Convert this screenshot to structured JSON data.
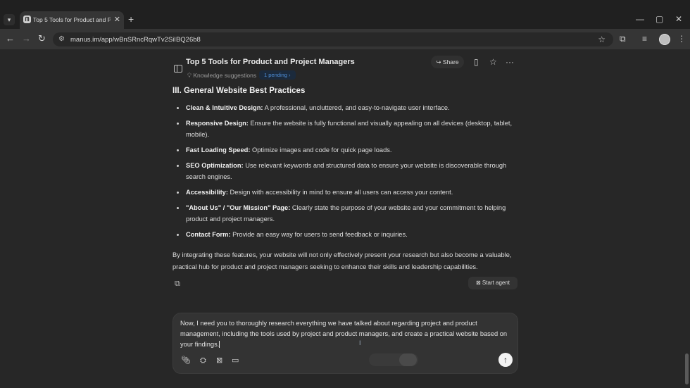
{
  "browser": {
    "tab": {
      "title": "Top 5 Tools for Product and Pro"
    },
    "url": "manus.im/app/wBnSRncRqwTv2SiIBQ26b8"
  },
  "header": {
    "title": "Top 5 Tools for Product and Project Managers",
    "knowledge_label": "Knowledge suggestions",
    "pending_badge": "1 pending",
    "share_label": "Share"
  },
  "content": {
    "section_title": "III. General Website Best Practices",
    "items": [
      {
        "label": "Clean & Intuitive Design:",
        "text": " A professional, uncluttered, and easy-to-navigate user interface."
      },
      {
        "label": "Responsive Design:",
        "text": " Ensure the website is fully functional and visually appealing on all devices (desktop, tablet, mobile)."
      },
      {
        "label": "Fast Loading Speed:",
        "text": " Optimize images and code for quick page loads."
      },
      {
        "label": "SEO Optimization:",
        "text": " Use relevant keywords and structured data to ensure your website is discoverable through search engines."
      },
      {
        "label": "Accessibility:",
        "text": " Design with accessibility in mind to ensure all users can access your content."
      },
      {
        "label": "\"About Us\" / \"Our Mission\" Page:",
        "text": " Clearly state the purpose of your website and your commitment to helping product and project managers."
      },
      {
        "label": "Contact Form:",
        "text": " Provide an easy way for users to send feedback or inquiries."
      }
    ],
    "summary": "By integrating these features, your website will not only effectively present your research but also become a valuable, practical hub for product and project managers seeking to enhance their skills and leadership capabilities.",
    "start_agent_label": "Start agent"
  },
  "composer": {
    "text": "Now, I need you to thoroughly research everything we have talked about regarding project and product management, including the tools used by project and product managers, and create a practical website based on your findings."
  },
  "icons": {
    "tab_favicon": "manus-logo-icon",
    "share": "share-arrow-icon",
    "send": "arrow-up-icon"
  },
  "colors": {
    "background": "#272727",
    "pending_badge_text": "#4f8fd8",
    "send_button": "#f2f2f2"
  }
}
